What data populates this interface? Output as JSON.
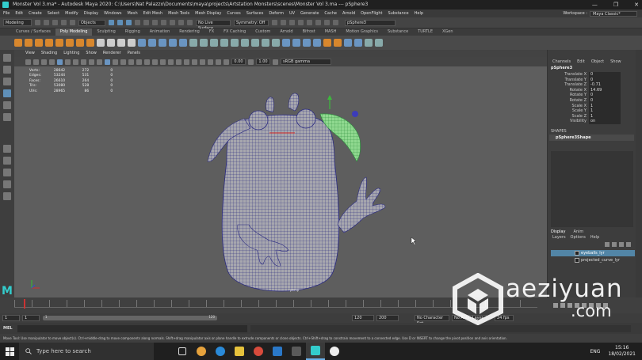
{
  "window": {
    "title": "Monster Vol 3.ma* - Autodesk Maya 2020: C:\\Users\\Nat Palazzo\\Documents\\maya\\projects\\Artstation Monsters\\scenes\\Monster Vol 3.ma  ---  pSphere3",
    "minimize": "—",
    "maximize": "❐",
    "close": "✕"
  },
  "menubar": {
    "items": [
      "File",
      "Edit",
      "Create",
      "Select",
      "Modify",
      "Display",
      "Windows",
      "Mesh",
      "Edit Mesh",
      "Mesh Tools",
      "Mesh Display",
      "Curves",
      "Surfaces",
      "Deform",
      "UV",
      "Generate",
      "Cache",
      "Arnold",
      "OpenFlight",
      "Substance",
      "Help"
    ],
    "workspace_label": "Workspace :",
    "workspace_value": "Maya Classic*"
  },
  "statusline": {
    "mode": "Modeling",
    "objects": "Objects",
    "live_surface": "No Live Surface",
    "symmetry": "Symmetry: Off",
    "object_field": "pSphere3"
  },
  "shelf": {
    "tabs": [
      "Curves / Surfaces",
      "Poly Modeling",
      "Sculpting",
      "Rigging",
      "Animation",
      "Rendering",
      "FX",
      "FX Caching",
      "Custom",
      "Arnold",
      "Bifrost",
      "MASH",
      "Motion Graphics",
      "Substance",
      "TURTLE",
      "XGen"
    ],
    "active_tab": "Poly Modeling"
  },
  "panel": {
    "menus": [
      "View",
      "Shading",
      "Lighting",
      "Show",
      "Renderer",
      "Panels"
    ],
    "value_a": "0.00",
    "value_b": "1.00",
    "color_space": "sRGB gamma"
  },
  "hud": {
    "rows": [
      {
        "label": "Verts:",
        "a": "28642",
        "b": "272",
        "c": "0"
      },
      {
        "label": "Edges:",
        "a": "53244",
        "b": "531",
        "c": "0"
      },
      {
        "label": "Faces:",
        "a": "26610",
        "b": "264",
        "c": "0"
      },
      {
        "label": "Tris:",
        "a": "53080",
        "b": "528",
        "c": "0"
      },
      {
        "label": "UVs:",
        "a": "28965",
        "b": "86",
        "c": "0"
      }
    ],
    "camera": "persp"
  },
  "channelbox": {
    "menus": [
      "Channels",
      "Edit",
      "Object",
      "Show"
    ],
    "object_name": "pSphere3",
    "attrs": [
      {
        "label": "Translate X",
        "value": "0"
      },
      {
        "label": "Translate Y",
        "value": "0"
      },
      {
        "label": "Translate Z",
        "value": "-0.71"
      },
      {
        "label": "Rotate X",
        "value": "14.69"
      },
      {
        "label": "Rotate Y",
        "value": "0"
      },
      {
        "label": "Rotate Z",
        "value": "0"
      },
      {
        "label": "Scale X",
        "value": "1"
      },
      {
        "label": "Scale Y",
        "value": "1"
      },
      {
        "label": "Scale Z",
        "value": "1"
      },
      {
        "label": "Visibility",
        "value": "on"
      }
    ],
    "shapes_label": "SHAPES",
    "shape_name": "pSphere3Shape"
  },
  "layers": {
    "tabs": [
      "Display",
      "Anim"
    ],
    "menus": [
      "Layers",
      "Options",
      "Help"
    ],
    "items": [
      {
        "name": "eyeballs_lyr",
        "selected": true
      },
      {
        "name": "projected_curve_lyr",
        "selected": false
      }
    ]
  },
  "range": {
    "start": "1",
    "inner_start": "1",
    "inner_end": "120",
    "end": "120",
    "end_b": "200",
    "character_set": "No Character Set",
    "anim_layer": "No Anim Layer",
    "fps": "24 fps"
  },
  "cmdline": {
    "label": "MEL"
  },
  "helpline": {
    "text": "Move Tool: Use manipulator to move object(s). Ctrl+middle-drag to move components along normals. Shift+drag manipulator axis or plane handle to extrude components or clone objects. Ctrl+Shift+drag to constrain movement to a connected edge. Use D or INSERT to change the pivot position and axis orientation."
  },
  "taskbar": {
    "search_placeholder": "Type here to search",
    "language": "ENG",
    "time": "15:16",
    "date": "18/02/2021"
  },
  "watermark": {
    "text": "aeziyuan",
    "suffix": ".com"
  },
  "colors": {
    "accent": "#5f8fb8",
    "selection": "#5285a6",
    "wireframe": "#2a2a80",
    "highlight_green": "#6ee06e",
    "maya_teal": "#33cccc"
  }
}
